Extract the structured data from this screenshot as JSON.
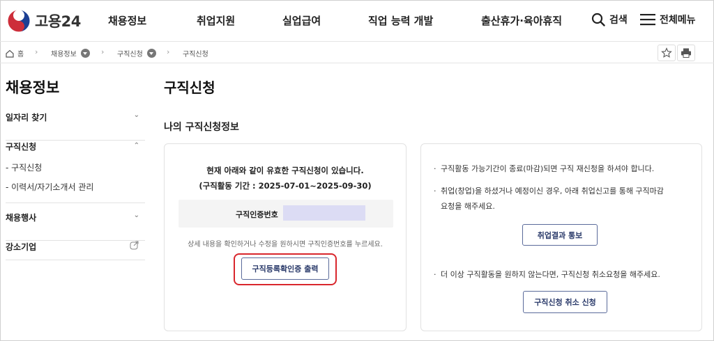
{
  "header": {
    "logo_text": "고용24",
    "nav": [
      "채용정보",
      "취업지원",
      "실업급여",
      "직업 능력 개발",
      "출산휴가·육아휴직"
    ],
    "search_label": "검색",
    "menu_label": "전체메뉴"
  },
  "breadcrumb": {
    "home": "홈",
    "level1": "채용정보",
    "level2": "구직신청",
    "level3": "구직신청"
  },
  "sidebar": {
    "title": "채용정보",
    "sections": [
      {
        "label": "일자리 찾기"
      },
      {
        "label": "구직신청",
        "items": [
          "- 구직신청",
          "- 이력서/자기소개서 관리"
        ]
      },
      {
        "label": "채용행사"
      },
      {
        "label": "강소기업"
      }
    ]
  },
  "main": {
    "page_title": "구직신청",
    "section_title": "나의 구직신청정보",
    "left_card": {
      "line1": "현재 아래와 같이 유효한 구직신청이 있습니다.",
      "line2": "(구직활동 기간 : 2025-07-01~2025-09-30)",
      "reg_label": "구직인증번호",
      "hint": "상세 내용을 확인하거나 수정을 원하시면 구직인증번호를 누르세요.",
      "print_button": "구직등록확인증 출력"
    },
    "right_card": {
      "bullet1": "구직활동 가능기간이 종료(마감)되면 구직 재신청을 하셔야 합니다.",
      "bullet2a": "취업(창업)을 하셨거나 예정이신 경우, 아래 취업신고를 통해 구직마감",
      "bullet2b": "요청을 해주세요.",
      "report_button": "취업결과 통보",
      "bullet3": "더 이상 구직활동을 원하지 않는다면, 구직신청 취소요청을 해주세요.",
      "cancel_button": "구직신청 취소 신청"
    }
  },
  "colors": {
    "highlight": "#d9262c",
    "button_border": "#5a6a9a",
    "masked_value": "#dcdcf4"
  }
}
